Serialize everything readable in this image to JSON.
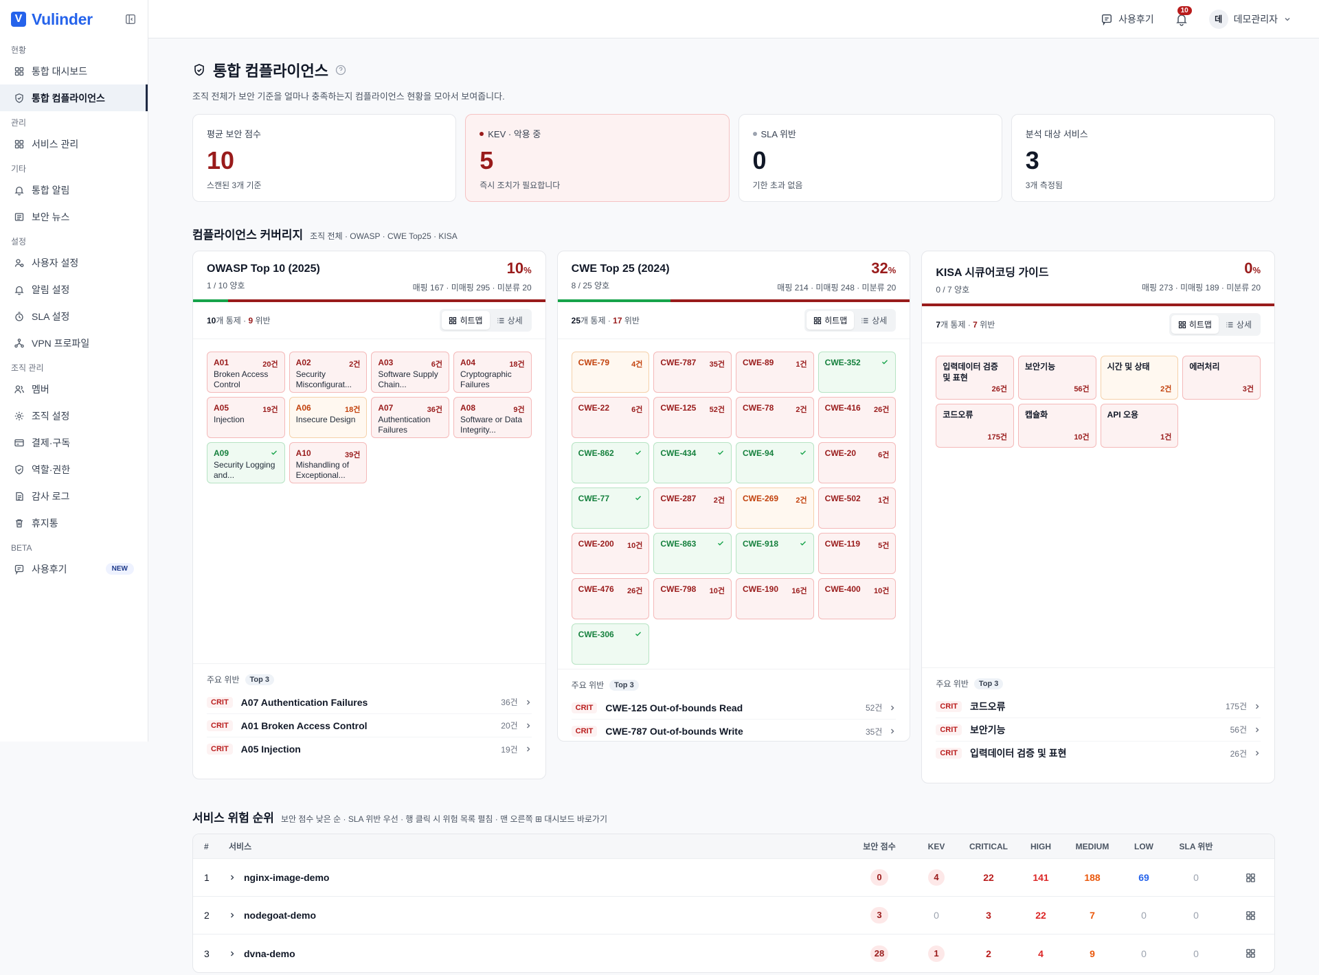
{
  "brand": {
    "mark": "V",
    "name": "Vulinder"
  },
  "topbar": {
    "review_label": "사용후기",
    "notif_count": "10",
    "avatar_initial": "데",
    "user_name": "데모관리자"
  },
  "sidebar": {
    "sections": [
      {
        "title": "현황",
        "items": [
          {
            "label": "통합 대시보드",
            "icon": "grid-icon"
          },
          {
            "label": "통합 컴플라이언스",
            "icon": "shield-icon",
            "active": true
          }
        ]
      },
      {
        "title": "관리",
        "items": [
          {
            "label": "서비스 관리",
            "icon": "grid-icon"
          }
        ]
      },
      {
        "title": "기타",
        "items": [
          {
            "label": "통합 알림",
            "icon": "bell-icon"
          },
          {
            "label": "보안 뉴스",
            "icon": "news-icon"
          }
        ]
      },
      {
        "title": "설정",
        "items": [
          {
            "label": "사용자 설정",
            "icon": "user-gear-icon"
          },
          {
            "label": "알림 설정",
            "icon": "bell-icon"
          },
          {
            "label": "SLA 설정",
            "icon": "timer-icon"
          },
          {
            "label": "VPN 프로파일",
            "icon": "network-icon"
          }
        ]
      },
      {
        "title": "조직 관리",
        "items": [
          {
            "label": "멤버",
            "icon": "members-icon"
          },
          {
            "label": "조직 설정",
            "icon": "gear-icon"
          },
          {
            "label": "결제·구독",
            "icon": "card-icon"
          },
          {
            "label": "역할·권한",
            "icon": "shield-icon"
          },
          {
            "label": "감사 로그",
            "icon": "log-icon"
          },
          {
            "label": "휴지통",
            "icon": "trash-icon"
          }
        ]
      },
      {
        "title": "BETA",
        "items": [
          {
            "label": "사용후기",
            "icon": "review-icon",
            "badge": "NEW"
          }
        ]
      }
    ]
  },
  "page": {
    "title": "통합 컴플라이언스",
    "description": "조직 전체가 보안 기준을 얼마나 충족하는지 컴플라이언스 현황을 모아서 보여줍니다."
  },
  "stats": [
    {
      "label": "평균 보안 점수",
      "value": "10",
      "sub": "스캔된 3개 기준",
      "value_color": "#991b1b",
      "dot": null,
      "variant": "normal"
    },
    {
      "label": "KEV · 악용 중",
      "value": "5",
      "sub": "즉시 조치가 필요합니다",
      "value_color": "#991b1b",
      "dot": "#991b1b",
      "variant": "kev"
    },
    {
      "label": "SLA 위반",
      "value": "0",
      "sub": "기한 초과 없음",
      "value_color": "#111827",
      "dot": "#9ca3af",
      "variant": "normal"
    },
    {
      "label": "분석 대상 서비스",
      "value": "3",
      "sub": "3개 측정됨",
      "value_color": "#111827",
      "dot": null,
      "variant": "normal"
    }
  ],
  "coverage": {
    "title": "컴플라이언스 커버리지",
    "subtitle": "조직 전체 · OWASP · CWE Top25 · KISA",
    "heatmap_label": "히트맵",
    "detail_label": "상세",
    "top_label": "주요 위반",
    "top_pill": "Top 3",
    "crit_label": "CRIT",
    "cards": [
      {
        "name": "OWASP Top 10 (2025)",
        "pct": "10",
        "pct_unit": "%",
        "pass_ratio": 0.1,
        "pass_text": "1 / 10 양호",
        "meta": "매핑 167 · 미매핑 295 · 미분류 20",
        "controls_num": "10",
        "controls_unit": "개 통제 · ",
        "viol_num": "9",
        "viol_unit": " 위반",
        "kind": "owasp",
        "tiles": [
          {
            "code": "A01",
            "name": "Broken Access Control",
            "count": "20건",
            "status": "red"
          },
          {
            "code": "A02",
            "name": "Security Misconfigurat...",
            "count": "2건",
            "status": "red"
          },
          {
            "code": "A03",
            "name": "Software Supply Chain...",
            "count": "6건",
            "status": "red"
          },
          {
            "code": "A04",
            "name": "Cryptographic Failures",
            "count": "18건",
            "status": "red"
          },
          {
            "code": "A05",
            "name": "Injection",
            "count": "19건",
            "status": "red"
          },
          {
            "code": "A06",
            "name": "Insecure Design",
            "count": "18건",
            "status": "orange"
          },
          {
            "code": "A07",
            "name": "Authentication Failures",
            "count": "36건",
            "status": "red"
          },
          {
            "code": "A08",
            "name": "Software or Data Integrity...",
            "count": "9건",
            "status": "red"
          },
          {
            "code": "A09",
            "name": "Security Logging and...",
            "count": "",
            "status": "green"
          },
          {
            "code": "A10",
            "name": "Mishandling of Exceptional...",
            "count": "39건",
            "status": "red"
          }
        ],
        "top": [
          {
            "name": "A07 Authentication Failures",
            "count": "36건"
          },
          {
            "name": "A01 Broken Access Control",
            "count": "20건"
          },
          {
            "name": "A05 Injection",
            "count": "19건"
          }
        ]
      },
      {
        "name": "CWE Top 25 (2024)",
        "pct": "32",
        "pct_unit": "%",
        "pass_ratio": 0.32,
        "pass_text": "8 / 25 양호",
        "meta": "매핑 214 · 미매핑 248 · 미분류 20",
        "controls_num": "25",
        "controls_unit": "개 통제 · ",
        "viol_num": "17",
        "viol_unit": " 위반",
        "kind": "cwe",
        "tiles": [
          {
            "code": "CWE-79",
            "count": "4건",
            "status": "orange"
          },
          {
            "code": "CWE-787",
            "count": "35건",
            "status": "red"
          },
          {
            "code": "CWE-89",
            "count": "1건",
            "status": "red"
          },
          {
            "code": "CWE-352",
            "count": "",
            "status": "green"
          },
          {
            "code": "CWE-22",
            "count": "6건",
            "status": "red"
          },
          {
            "code": "CWE-125",
            "count": "52건",
            "status": "red"
          },
          {
            "code": "CWE-78",
            "count": "2건",
            "status": "red"
          },
          {
            "code": "CWE-416",
            "count": "26건",
            "status": "red"
          },
          {
            "code": "CWE-862",
            "count": "",
            "status": "green"
          },
          {
            "code": "CWE-434",
            "count": "",
            "status": "green"
          },
          {
            "code": "CWE-94",
            "count": "",
            "status": "green"
          },
          {
            "code": "CWE-20",
            "count": "6건",
            "status": "red"
          },
          {
            "code": "CWE-77",
            "count": "",
            "status": "green"
          },
          {
            "code": "CWE-287",
            "count": "2건",
            "status": "red"
          },
          {
            "code": "CWE-269",
            "count": "2건",
            "status": "orange"
          },
          {
            "code": "CWE-502",
            "count": "1건",
            "status": "red"
          },
          {
            "code": "CWE-200",
            "count": "10건",
            "status": "red"
          },
          {
            "code": "CWE-863",
            "count": "",
            "status": "green"
          },
          {
            "code": "CWE-918",
            "count": "",
            "status": "green"
          },
          {
            "code": "CWE-119",
            "count": "5건",
            "status": "red"
          },
          {
            "code": "CWE-476",
            "count": "26건",
            "status": "red"
          },
          {
            "code": "CWE-798",
            "count": "10건",
            "status": "red"
          },
          {
            "code": "CWE-190",
            "count": "16건",
            "status": "red"
          },
          {
            "code": "CWE-400",
            "count": "10건",
            "status": "red"
          },
          {
            "code": "CWE-306",
            "count": "",
            "status": "green"
          }
        ],
        "top": [
          {
            "name": "CWE-125 Out-of-bounds Read",
            "count": "52건"
          },
          {
            "name": "CWE-787 Out-of-bounds Write",
            "count": "35건"
          }
        ]
      },
      {
        "name": "KISA 시큐어코딩 가이드",
        "pct": "0",
        "pct_unit": "%",
        "pass_ratio": 0,
        "pass_text": "0 / 7 양호",
        "meta": "매핑 273 · 미매핑 189 · 미분류 20",
        "controls_num": "7",
        "controls_unit": "개 통제 · ",
        "viol_num": "7",
        "viol_unit": " 위반",
        "kind": "kisa",
        "tiles": [
          {
            "name": "입력데이터 검증 및 표현",
            "count": "26건",
            "status": "red"
          },
          {
            "name": "보안기능",
            "count": "56건",
            "status": "red"
          },
          {
            "name": "시간 및 상태",
            "count": "2건",
            "status": "orange"
          },
          {
            "name": "에러처리",
            "count": "3건",
            "status": "red"
          },
          {
            "name": "코드오류",
            "count": "175건",
            "status": "red"
          },
          {
            "name": "캡슐화",
            "count": "10건",
            "status": "red"
          },
          {
            "name": "API 오용",
            "count": "1건",
            "status": "red"
          }
        ],
        "top": [
          {
            "name": "코드오류",
            "count": "175건"
          },
          {
            "name": "보안기능",
            "count": "56건"
          },
          {
            "name": "입력데이터 검증 및 표현",
            "count": "26건"
          }
        ]
      }
    ]
  },
  "risk": {
    "title": "서비스 위험 순위",
    "subtitle": "보안 점수 낮은 순 · SLA 위반 우선 · 행 클릭 시 위험 목록 펼침 · 맨 오른쪽 ⊞ 대시보드 바로가기",
    "headers": {
      "rank": "#",
      "service": "서비스",
      "score": "보안 점수",
      "kev": "KEV",
      "critical": "CRITICAL",
      "high": "HIGH",
      "medium": "MEDIUM",
      "low": "LOW",
      "sla": "SLA 위반"
    },
    "rows": [
      {
        "rank": "1",
        "name": "nginx-image-demo",
        "score": "0",
        "kev": "4",
        "critical": "22",
        "high": "141",
        "medium": "188",
        "low": "69",
        "sla": "0"
      },
      {
        "rank": "2",
        "name": "nodegoat-demo",
        "score": "3",
        "kev": "0",
        "critical": "3",
        "high": "22",
        "medium": "7",
        "low": "0",
        "sla": "0"
      },
      {
        "rank": "3",
        "name": "dvna-demo",
        "score": "28",
        "kev": "1",
        "critical": "2",
        "high": "4",
        "medium": "9",
        "low": "0",
        "sla": "0"
      }
    ]
  },
  "colors": {
    "brand": "#2563eb",
    "critical": "#991b1b",
    "pass": "#16a34a",
    "warn": "#c2410c"
  }
}
